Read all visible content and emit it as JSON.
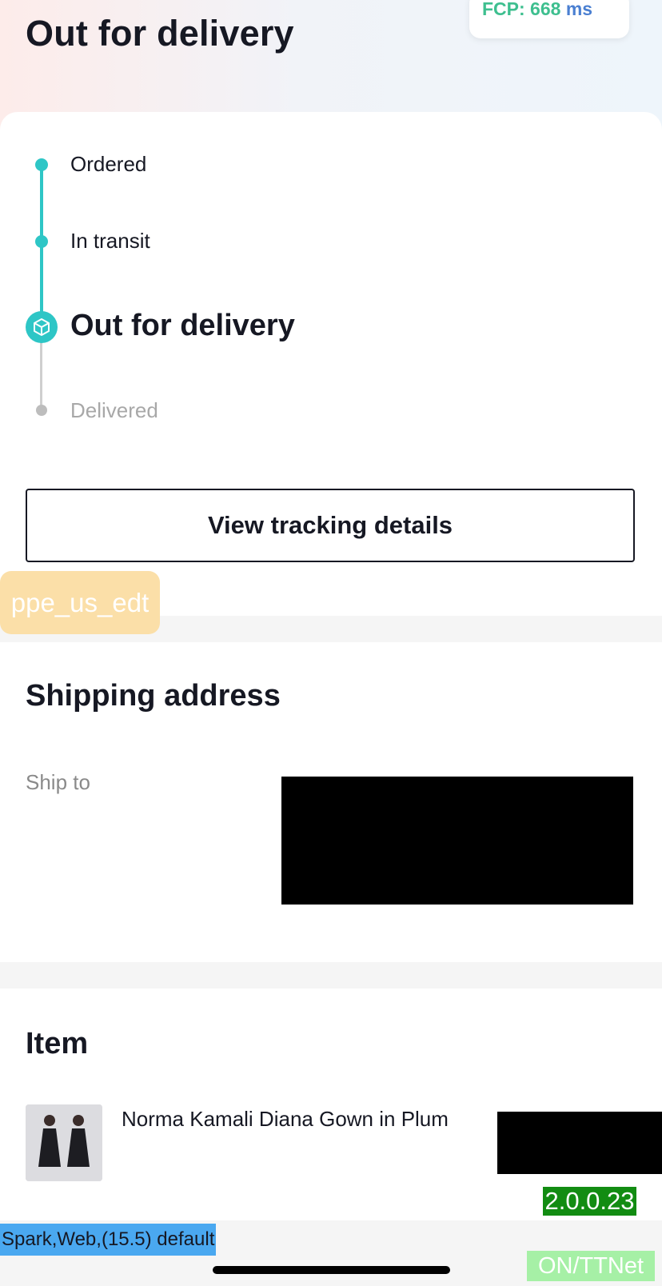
{
  "header": {
    "title": "Out for delivery",
    "fcp_label": "FCP: 668",
    "fcp_unit": "ms"
  },
  "tracking": {
    "steps": [
      {
        "label": "Ordered",
        "state": "done"
      },
      {
        "label": "In transit",
        "state": "done"
      },
      {
        "label": "Out for delivery",
        "state": "current"
      },
      {
        "label": "Delivered",
        "state": "pending"
      }
    ],
    "view_button": "View tracking details",
    "accent_color": "#2ec6c6"
  },
  "debug": {
    "env_badge": "ppe_us_edt",
    "version": "2.0.0.23",
    "spark_info": "Spark,Web,(15.5) default",
    "net_info": "ON/TTNet"
  },
  "shipping": {
    "title": "Shipping address",
    "ship_to_label": "Ship to"
  },
  "item": {
    "title": "Item",
    "name": "Norma Kamali Diana Gown in Plum"
  }
}
